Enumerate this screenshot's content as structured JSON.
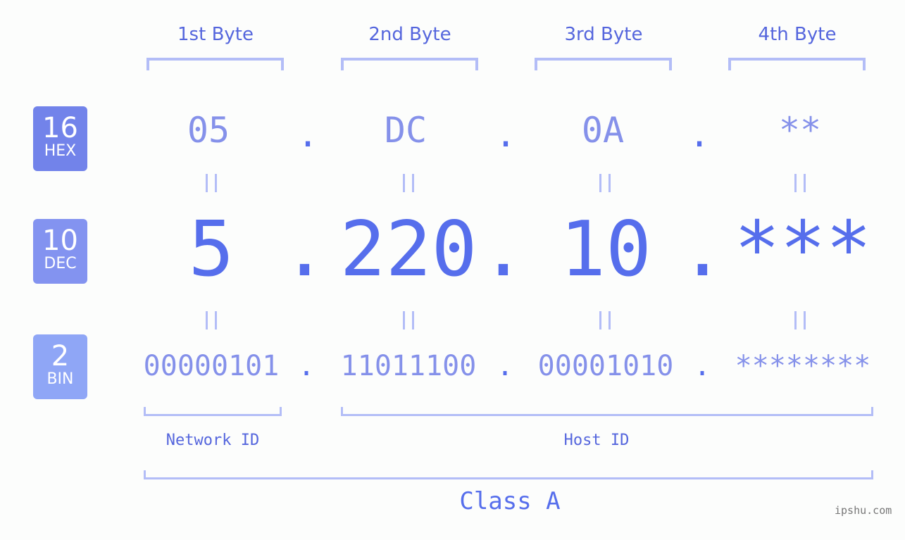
{
  "byte_headers": [
    "1st Byte",
    "2nd Byte",
    "3rd Byte",
    "4th Byte"
  ],
  "rows": {
    "hex": {
      "base": "16",
      "label": "HEX",
      "color": "#7283ea",
      "values": [
        "05",
        "DC",
        "0A",
        "**"
      ]
    },
    "dec": {
      "base": "10",
      "label": "DEC",
      "color": "#8393f0",
      "values": [
        "5",
        "220",
        "10",
        "***"
      ]
    },
    "bin": {
      "base": "2",
      "label": "BIN",
      "color": "#8fa6f6",
      "values": [
        "00000101",
        "11011100",
        "00001010",
        "********"
      ]
    }
  },
  "separator": ".",
  "network_id_label": "Network ID",
  "host_id_label": "Host ID",
  "class_label": "Class A",
  "watermark": "ipshu.com",
  "colors": {
    "accent": "#566eec",
    "light": "#8591ea",
    "bracket": "#b3bdf7",
    "text": "#5566dd"
  }
}
